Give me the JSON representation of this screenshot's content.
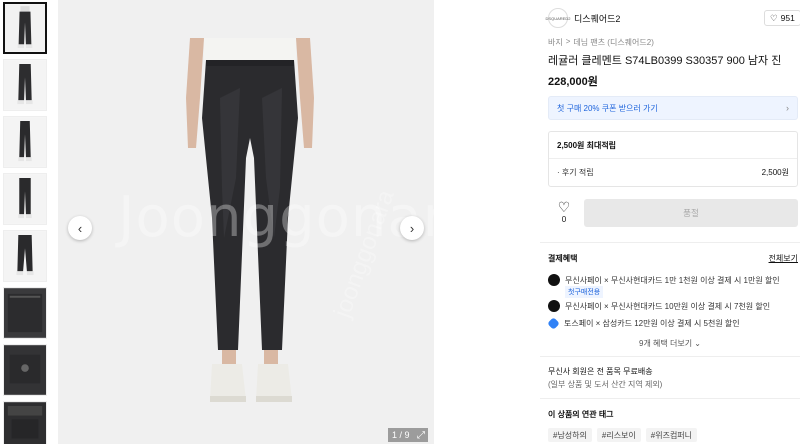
{
  "gallery": {
    "counter": "1 / 9",
    "prev_icon": "‹",
    "next_icon": "›",
    "more_icon": "›",
    "expand_icon": "⤢",
    "watermark": "Joonggonara",
    "watermark_small": "joonggonara"
  },
  "seller": {
    "logo_text": "DSQUARED2",
    "name": "디스퀘어드2",
    "like_icon": "heart-outline-icon",
    "like_count": "951"
  },
  "breadcrumb": [
    "바지",
    "데님 팬츠 (디스퀘어드2)"
  ],
  "breadcrumb_sep": ">",
  "product": {
    "title": "레귤러 클레멘트 S74LB0399 S30357 900 남자 진",
    "price": "228,000원"
  },
  "coupon": {
    "label": "첫 구매 20% 쿠폰 받으러 가기",
    "chevron": "›"
  },
  "points": {
    "max": "2,500원 최대적립",
    "review_label": "· 후기 적립",
    "review_value": "2,500원"
  },
  "actions": {
    "heart_icon": "♡",
    "heart_count": "0",
    "buy_label": "품절"
  },
  "benefits": {
    "title": "결제혜택",
    "view_all": "전체보기",
    "items": [
      {
        "text": "무신사페이 × 무신사현대카드 1만 1천원 이상 결제 시 1만원 할인",
        "icon": "musinsa-pay-icon"
      },
      {
        "text": "무신사페이 × 무신사현대카드 10만원 이상 결제 시 7천원 할인",
        "icon": "musinsa-pay-icon"
      },
      {
        "text": "토스페이 × 삼성카드 12만원 이상 결제 시 5천원 할인",
        "icon": "toss-pay-icon"
      }
    ],
    "first_tag": "첫구매전용",
    "more": "9개 혜택 더보기 ⌄"
  },
  "shipping": {
    "title": "무신사 회원은 전 품목 무료배송",
    "sub": "(일부 상품 및 도서 산간 지역 제외)"
  },
  "related_tags": {
    "title": "이 상품의 연관 태그",
    "items": [
      "#남성하의",
      "#리스보이",
      "#위즈컴퍼니"
    ]
  },
  "colors": {
    "accent_blue": "#1e64dc",
    "coupon_bg": "#eef4ff",
    "disabled_btn": "#e8e8e8"
  }
}
